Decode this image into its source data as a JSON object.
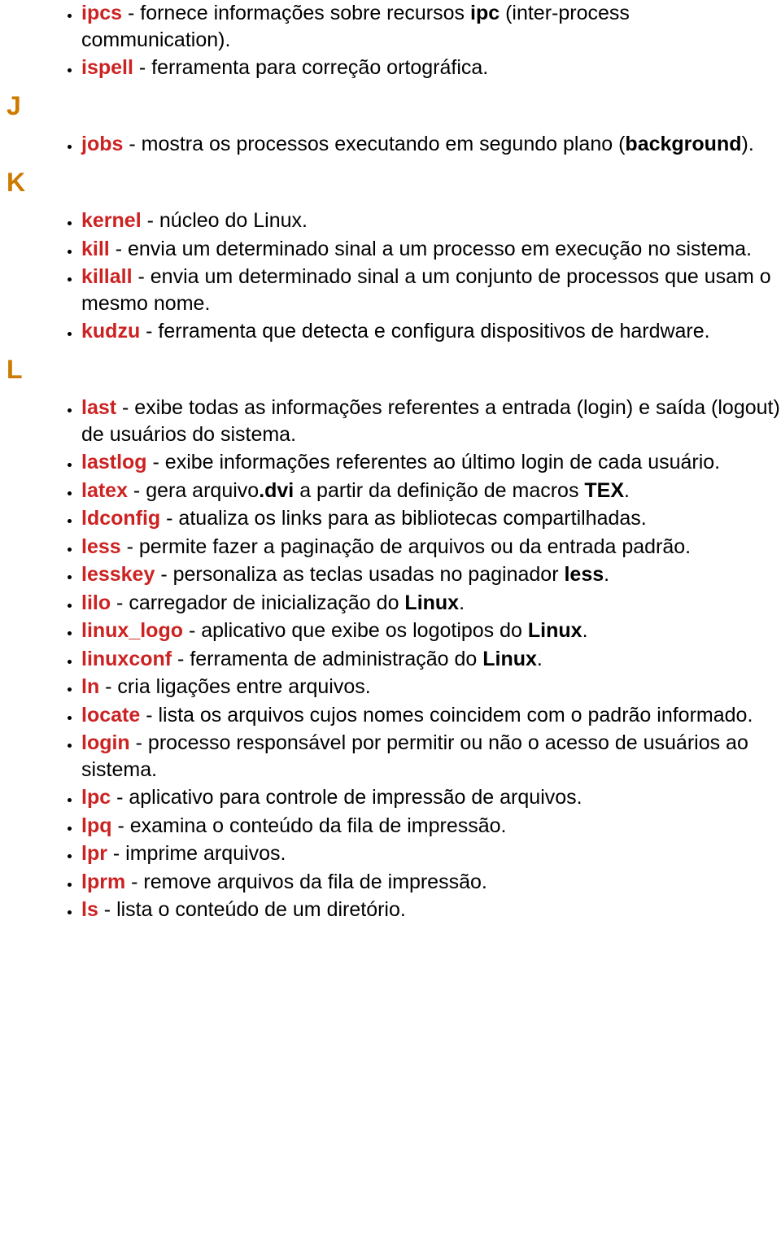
{
  "sections": {
    "I_continued": [
      {
        "term": "ipcs",
        "desc_before": " - fornece informações sobre recursos ",
        "bold1": "ipc",
        "desc_mid": " (inter-process communication).",
        "desc_after": ""
      },
      {
        "term": "ispell",
        "desc_before": " - ferramenta para correção ortográfica.",
        "bold1": "",
        "desc_mid": "",
        "desc_after": ""
      }
    ],
    "J_letter": "J",
    "J": [
      {
        "term": "jobs",
        "desc_before": " - mostra os processos executando em segundo plano (",
        "bold1": "background",
        "desc_mid": ").",
        "desc_after": ""
      }
    ],
    "K_letter": "K",
    "K": [
      {
        "term": "kernel",
        "desc_before": " - núcleo do Linux.",
        "bold1": "",
        "desc_mid": "",
        "desc_after": ""
      },
      {
        "term": "kill",
        "desc_before": " - envia um determinado sinal a um processo em execução no sistema.",
        "bold1": "",
        "desc_mid": "",
        "desc_after": ""
      },
      {
        "term": "killall",
        "desc_before": " - envia um determinado sinal a um conjunto de processos que usam o mesmo nome.",
        "bold1": "",
        "desc_mid": "",
        "desc_after": ""
      },
      {
        "term": "kudzu",
        "desc_before": " - ferramenta que detecta e configura dispositivos de hardware.",
        "bold1": "",
        "desc_mid": "",
        "desc_after": ""
      }
    ],
    "L_letter": "L",
    "L": [
      {
        "term": "last",
        "desc_before": " - exibe todas as informações referentes a entrada (login) e saída (logout) de usuários do sistema.",
        "bold1": "",
        "desc_mid": "",
        "desc_after": ""
      },
      {
        "term": "lastlog",
        "desc_before": " - exibe informações referentes ao último login de cada usuário.",
        "bold1": "",
        "desc_mid": "",
        "desc_after": ""
      },
      {
        "term": "latex",
        "desc_before": " - gera arquivo",
        "bold1": ".dvi",
        "desc_mid": " a partir da definição de macros ",
        "bold2": "TEX",
        "desc_after": "."
      },
      {
        "term": "ldconfig",
        "desc_before": " - atualiza os links para as bibliotecas compartilhadas.",
        "bold1": "",
        "desc_mid": "",
        "desc_after": ""
      },
      {
        "term": "less",
        "desc_before": " - permite fazer a paginação de arquivos ou da entrada padrão.",
        "bold1": "",
        "desc_mid": "",
        "desc_after": ""
      },
      {
        "term": "lesskey",
        "desc_before": " - personaliza as teclas usadas no paginador ",
        "bold1": "less",
        "desc_mid": ".",
        "desc_after": ""
      },
      {
        "term": "lilo",
        "desc_before": " - carregador de inicialização do ",
        "bold1": "Linux",
        "desc_mid": ".",
        "desc_after": ""
      },
      {
        "term": "linux_logo",
        "desc_before": " - aplicativo que exibe os logotipos do ",
        "bold1": "Linux",
        "desc_mid": ".",
        "desc_after": ""
      },
      {
        "term": "linuxconf",
        "desc_before": " - ferramenta de administração do ",
        "bold1": "Linux",
        "desc_mid": ".",
        "desc_after": ""
      },
      {
        "term": "ln",
        "desc_before": " - cria ligações entre arquivos.",
        "bold1": "",
        "desc_mid": "",
        "desc_after": ""
      },
      {
        "term": "locate",
        "desc_before": " - lista os arquivos cujos nomes coincidem com o padrão informado.",
        "bold1": "",
        "desc_mid": "",
        "desc_after": ""
      },
      {
        "term": "login",
        "desc_before": " - processo responsável por permitir ou não o acesso de usuários ao sistema.",
        "bold1": "",
        "desc_mid": "",
        "desc_after": ""
      },
      {
        "term": "lpc",
        "desc_before": " - aplicativo para controle de impressão de arquivos.",
        "bold1": "",
        "desc_mid": "",
        "desc_after": ""
      },
      {
        "term": "lpq",
        "desc_before": " - examina o conteúdo da fila de impressão.",
        "bold1": "",
        "desc_mid": "",
        "desc_after": ""
      },
      {
        "term": "lpr",
        "desc_before": " - imprime arquivos.",
        "bold1": "",
        "desc_mid": "",
        "desc_after": ""
      },
      {
        "term": "lprm",
        "desc_before": " - remove arquivos da fila de impressão.",
        "bold1": "",
        "desc_mid": "",
        "desc_after": ""
      },
      {
        "term": "ls",
        "desc_before": " - lista o conteúdo de um diretório.",
        "bold1": "",
        "desc_mid": "",
        "desc_after": ""
      }
    ]
  }
}
